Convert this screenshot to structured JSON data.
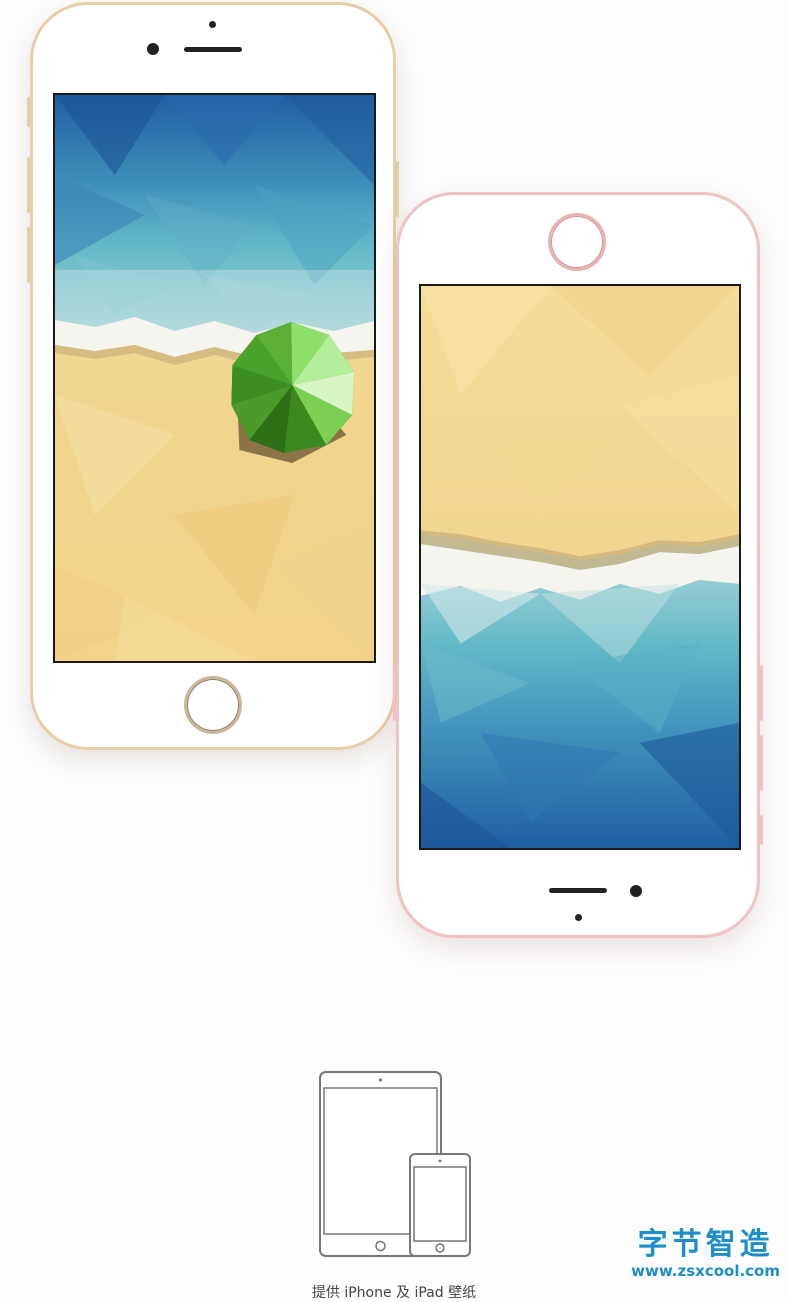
{
  "caption": "提供 iPhone 及 iPad 壁纸",
  "watermark": {
    "title": "字节智造",
    "url": "www.zsxcool.com"
  },
  "phones": [
    {
      "name": "gold-iphone",
      "color": "#e6cfa8",
      "wallpaper": "beach-with-green-umbrella"
    },
    {
      "name": "rose-iphone",
      "color": "#f1c2c4",
      "wallpaper": "beach-waves-inverted"
    }
  ],
  "icons": [
    "ipad-and-iphone-outline-icon"
  ],
  "colors": {
    "sand": "#f2d58e",
    "sea_light": "#5cb3c4",
    "sea_deep": "#1f64a8",
    "umbrella": "#4ea82c",
    "watermark": "#1e8ec8"
  }
}
